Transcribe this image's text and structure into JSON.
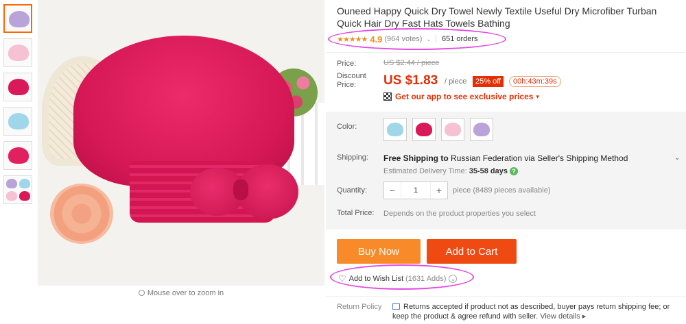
{
  "product": {
    "title": "Ouneed Happy Quick Dry Towel Newly Textile Useful Dry Microfiber Turban Quick Hair Dry Fast Hats Towels Bathing",
    "stars": "★★★★★",
    "rating": "4.9",
    "votes": "(964 votes)",
    "orders": "651 orders"
  },
  "price": {
    "price_label": "Price:",
    "old_price": "US $2.44 / piece",
    "discount_label": "Discount Price:",
    "current_price": "US $1.83",
    "per_unit": "/ piece",
    "discount_badge": "25% off",
    "countdown": "00h:43m:39s",
    "app_promo": "Get our app to see exclusive prices"
  },
  "options": {
    "color_label": "Color:",
    "colors": [
      "#9fd6ea",
      "#d9195a",
      "#f5c1d3",
      "#b9a3d9"
    ],
    "shipping_label": "Shipping:",
    "shipping_bold": "Free Shipping to",
    "shipping_rest": "Russian Federation via Seller's Shipping Method",
    "est_label": "Estimated Delivery Time:",
    "est_value": "35-58 days",
    "quantity_label": "Quantity:",
    "quantity_value": "1",
    "quantity_note": "piece (8489 pieces available)",
    "total_label": "Total Price:",
    "total_note": "Depends on the product properties you select"
  },
  "actions": {
    "buy_now": "Buy Now",
    "add_to_cart": "Add to Cart",
    "wish_label": "Add to Wish List",
    "wish_count": "(1631 Adds)"
  },
  "policy": {
    "label": "Return Policy",
    "text": "Returns accepted if product not as described, buyer pays return shipping fee; or keep the product & agree refund with seller.",
    "link": "View details ▸"
  },
  "gallery": {
    "zoom_hint": "Mouse over to zoom in"
  },
  "colors": {
    "accent": "#e62e04",
    "buy": "#f88a2a",
    "cart": "#f04a13",
    "rating": "#f58b1c",
    "highlight": "#e44ae4"
  }
}
